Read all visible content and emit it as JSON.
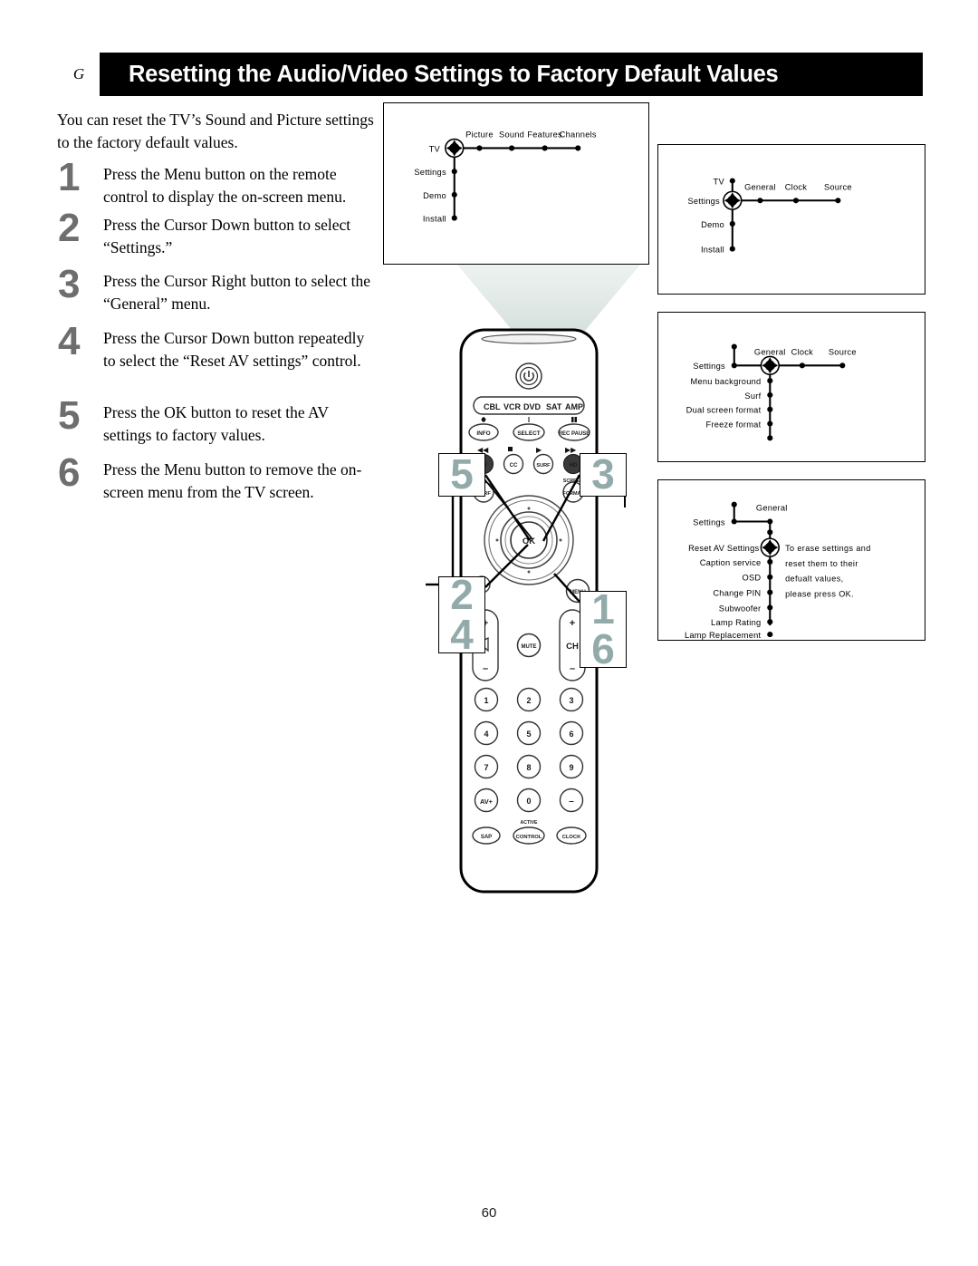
{
  "page": {
    "chapter_badge": "G",
    "title": "Resetting the Audio/Video Settings to Factory Default Values",
    "page_number": "60",
    "intro": "You can reset the TV’s Sound and Picture settings to the factory default values."
  },
  "steps": [
    {
      "number": "1",
      "text": "Press the Menu button on the remote control to display the on-screen menu."
    },
    {
      "number": "2",
      "text": "Press the Cursor Down button to select “Settings.”"
    },
    {
      "number": "3",
      "text": "Press the Cursor Right button to select the “General” menu."
    },
    {
      "number": "4",
      "text": "Press the Cursor Down button repeatedly to select the “Reset AV settings” control."
    },
    {
      "number": "5",
      "text": "Press the OK button to reset the AV settings to factory values."
    },
    {
      "number": "6",
      "text": "Press the Menu button to remove the on-screen menu from the TV screen."
    }
  ],
  "menus": {
    "panel_1": {
      "vertical_items": [
        "TV",
        "Settings",
        "Demo",
        "Install"
      ],
      "horizontal_items": [
        "Picture",
        "Sound",
        "Features",
        "Channels"
      ],
      "selected": "TV"
    },
    "panel_2": {
      "vertical_items": [
        "TV",
        "Settings",
        "Demo",
        "Install"
      ],
      "horizontal_items": [
        "General",
        "Clock",
        "Source"
      ],
      "selected": "Settings"
    },
    "panel_3": {
      "vertical_items": [
        "Settings"
      ],
      "horizontal_items": [
        "General",
        "Clock",
        "Source"
      ],
      "sub_items": [
        "Menu background",
        "Surf",
        "Dual screen format",
        "Freeze format"
      ],
      "selected": "General"
    },
    "panel_4": {
      "vertical_items": [
        "Settings"
      ],
      "horizontal_items": [
        "General"
      ],
      "sub_items": [
        "Reset AV Settings",
        "Caption service",
        "OSD",
        "Change PIN",
        "Subwoofer",
        "Lamp Rating",
        "Lamp Replacement"
      ],
      "selected": "Reset AV Settings",
      "note_lines": [
        "To erase settings and",
        "reset them to their",
        "defualt values,",
        "please press OK."
      ]
    }
  },
  "remote": {
    "power_icon": "power-icon",
    "device_keys": [
      "CBL",
      "VCR",
      "DVD",
      "SAT",
      "AMP"
    ],
    "row_info": [
      "INFO",
      "SELECT",
      "REC PAUSE"
    ],
    "row_transport": [
      "TV",
      "CC",
      "SURF",
      "HD"
    ],
    "row_surf_format": [
      "SURF",
      "FORMAT"
    ],
    "format_label": "SCREEN",
    "ok_label": "OK",
    "menu_label": "MENU",
    "mute_label": "MUTE",
    "channel_label": "CH",
    "plus_label": "+",
    "minus_label": "–",
    "keypad": [
      "1",
      "2",
      "3",
      "4",
      "5",
      "6",
      "7",
      "8",
      "9",
      "AV+",
      "0",
      "–"
    ],
    "bottom_keys": [
      "SAP",
      "CONTROL",
      "CLOCK"
    ],
    "active_label": "ACTIVE"
  },
  "callouts": {
    "ok_button": [
      "5"
    ],
    "cursor_right": [
      "3"
    ],
    "cursor_down": [
      "2",
      "4"
    ],
    "menu_button": [
      "1",
      "6"
    ]
  },
  "colors": {
    "callout_number": "#92aaaa",
    "step_number": "#6e6e6e",
    "header_bar": "#000000",
    "cone": "#dde5e3"
  }
}
